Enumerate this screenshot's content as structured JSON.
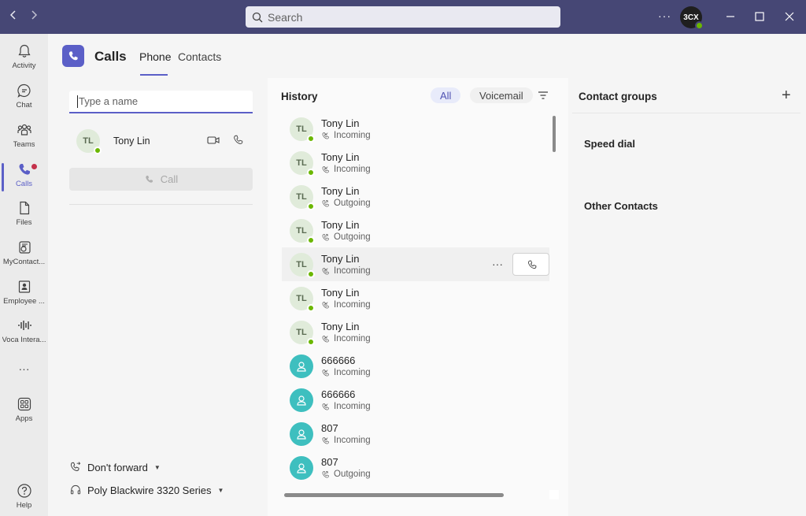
{
  "titlebar": {
    "search_placeholder": "Search",
    "more_label": "···",
    "avatar_text": "3CX"
  },
  "rail": [
    {
      "label": "Activity",
      "icon": "bell-icon"
    },
    {
      "label": "Chat",
      "icon": "chat-icon"
    },
    {
      "label": "Teams",
      "icon": "teams-icon"
    },
    {
      "label": "Calls",
      "icon": "phone-icon"
    },
    {
      "label": "Files",
      "icon": "file-icon"
    },
    {
      "label": "MyContact...",
      "icon": "contact-app-icon"
    },
    {
      "label": "Employee ...",
      "icon": "employee-app-icon"
    },
    {
      "label": "Voca Intera...",
      "icon": "voice-wave-icon"
    },
    {
      "label": "···",
      "icon": "more-icon"
    },
    {
      "label": "Apps",
      "icon": "apps-icon"
    },
    {
      "label": "Help",
      "icon": "help-icon"
    }
  ],
  "header": {
    "title": "Calls",
    "tabs": [
      {
        "label": "Phone",
        "active": true
      },
      {
        "label": "Contacts",
        "active": false
      }
    ]
  },
  "dialer": {
    "placeholder": "Type a name",
    "suggestion": {
      "initials": "TL",
      "name": "Tony Lin"
    },
    "call_label": "Call",
    "forward_label": "Don't forward",
    "device_label": "Poly Blackwire 3320 Series"
  },
  "history": {
    "title": "History",
    "filters": [
      "All",
      "Voicemail"
    ],
    "rows": [
      {
        "initials": "TL",
        "name": "Tony Lin",
        "status": "Incoming",
        "type": "person"
      },
      {
        "initials": "TL",
        "name": "Tony Lin",
        "status": "Incoming",
        "type": "person"
      },
      {
        "initials": "TL",
        "name": "Tony Lin",
        "status": "Outgoing",
        "type": "person"
      },
      {
        "initials": "TL",
        "name": "Tony Lin",
        "status": "Outgoing",
        "type": "person"
      },
      {
        "initials": "TL",
        "name": "Tony Lin",
        "status": "Incoming",
        "type": "person",
        "hover": true
      },
      {
        "initials": "TL",
        "name": "Tony Lin",
        "status": "Incoming",
        "type": "person"
      },
      {
        "initials": "TL",
        "name": "Tony Lin",
        "status": "Incoming",
        "type": "person"
      },
      {
        "initials": "",
        "name": "666666",
        "status": "Incoming",
        "type": "number"
      },
      {
        "initials": "",
        "name": "666666",
        "status": "Incoming",
        "type": "number"
      },
      {
        "initials": "",
        "name": "807",
        "status": "Incoming",
        "type": "number"
      },
      {
        "initials": "",
        "name": "807",
        "status": "Outgoing",
        "type": "number"
      }
    ]
  },
  "groups": {
    "title": "Contact groups",
    "items": [
      "Speed dial",
      "Other Contacts"
    ]
  },
  "colors": {
    "accent": "#5b5fc7",
    "titlebar": "#464775",
    "presence": "#6bb700",
    "teal_avatar": "#3ebfbf"
  }
}
